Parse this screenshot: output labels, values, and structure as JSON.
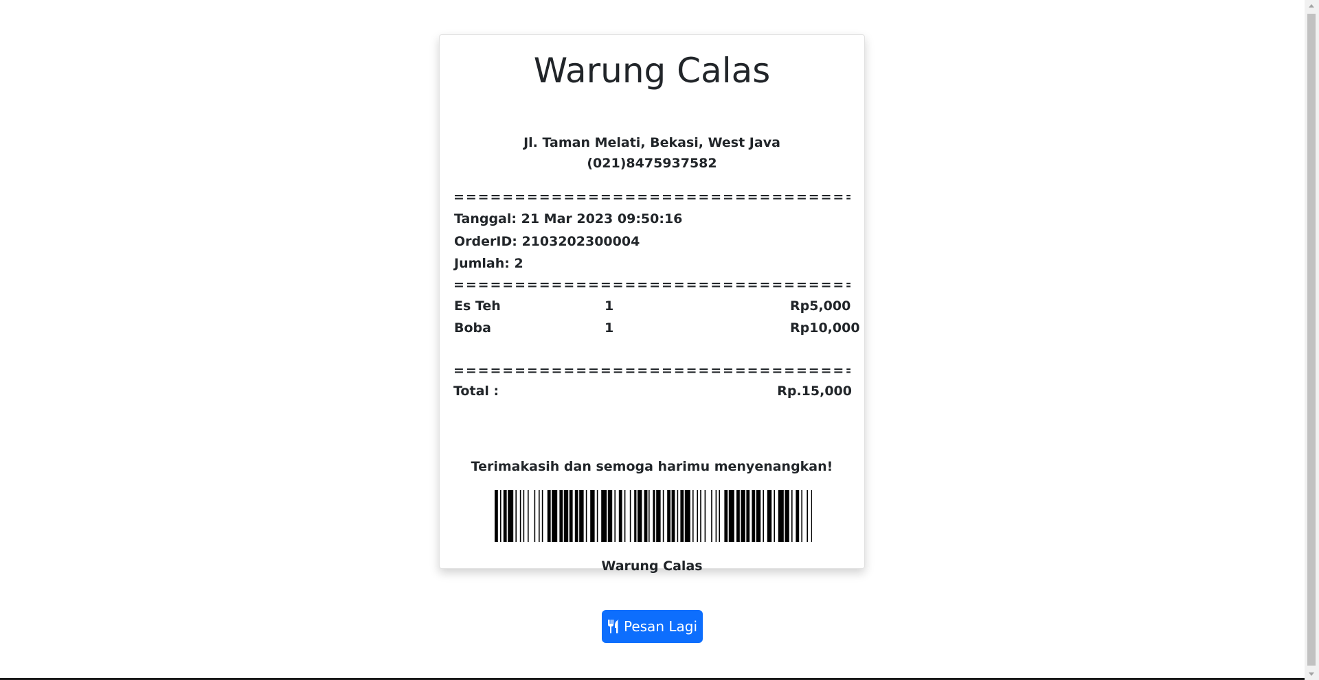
{
  "receipt": {
    "store_name": "Warung Calas",
    "address": "Jl. Taman Melati, Bekasi, West Java",
    "phone": "(021)8475937582",
    "separator": "========================================",
    "info": [
      {
        "label": "Tanggal",
        "value": "21 Mar 2023 09:50:16"
      },
      {
        "label": "OrderID",
        "value": "2103202300004"
      },
      {
        "label": "Jumlah ",
        "value": "2"
      }
    ],
    "items": [
      {
        "name": "Es Teh",
        "qty": "1",
        "price": "Rp5,000"
      },
      {
        "name": "Boba",
        "qty": "1",
        "price": "Rp10,000"
      }
    ],
    "total_label": "Total :",
    "total_value": "Rp.15,000",
    "thanks": "Terimakasih dan semoga harimu menyenangkan!",
    "footer_name": "Warung Calas"
  },
  "actions": {
    "order_again_label": "Pesan Lagi",
    "order_again_icon": "utensils-icon"
  },
  "colors": {
    "primary_button": "#0d6efd",
    "text": "#212529"
  }
}
